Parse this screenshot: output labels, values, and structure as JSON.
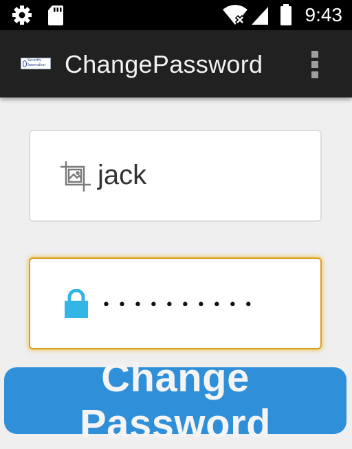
{
  "status_bar": {
    "time": "9:43",
    "icons": [
      "settings-icon",
      "sd-card-icon",
      "wifi-off-icon",
      "signal-icon",
      "battery-icon"
    ]
  },
  "app_bar": {
    "title": "ChangePassword",
    "logo_text": "Security\nInnovation",
    "overflow_icon": "more-vert-icon"
  },
  "form": {
    "username_value": "jack",
    "username_icon": "image-crop-icon",
    "password_masked": "••••••••••",
    "password_icon": "lock-icon",
    "submit_label": "Change Password"
  },
  "colors": {
    "status_bar_bg": "#000000",
    "app_bar_bg": "#212121",
    "page_bg": "#efefef",
    "focus_border": "#d6a21a",
    "lock_icon": "#33b5e5",
    "button_bg": "#2f8fd8",
    "button_text": "#f4f4f4"
  }
}
